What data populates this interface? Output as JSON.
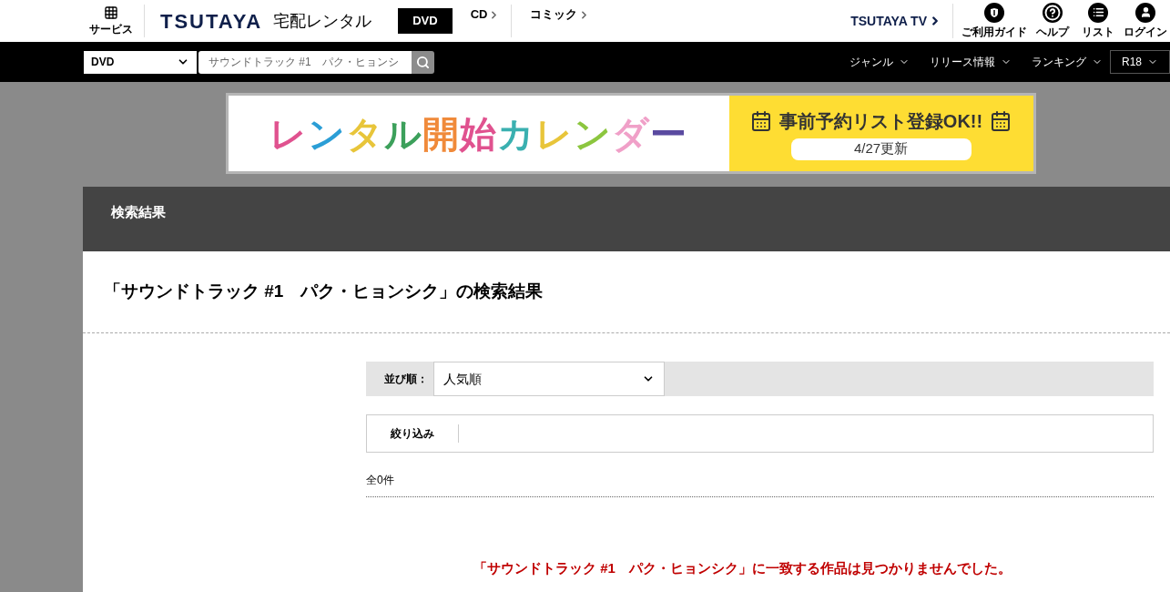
{
  "header": {
    "service_label": "サービス",
    "logo": "TSUTAYA",
    "service_name": "宅配レンタル",
    "tabs": [
      {
        "label": "DVD",
        "selected": true
      },
      {
        "label": "CD",
        "selected": false
      },
      {
        "label": "コミック",
        "selected": false
      }
    ],
    "tv_link": "TSUTAYA TV",
    "icon_links": [
      {
        "kind": "guide",
        "label": "ご利用ガイド"
      },
      {
        "kind": "help",
        "label": "ヘルプ"
      },
      {
        "kind": "list",
        "label": "リスト"
      },
      {
        "kind": "login",
        "label": "ログイン"
      }
    ]
  },
  "search_bar": {
    "category": "DVD",
    "query": "サウンドトラック #1　パク・ヒョンシ",
    "menus": [
      "ジャンル",
      "リリース情報",
      "ランキング"
    ],
    "rating_select": "R18"
  },
  "banner": {
    "title": "レンタル開始カレンダー",
    "subtitle": "事前予約リスト登録OK!!",
    "date": "4/27更新"
  },
  "section_header": "検索結果",
  "result_title": "「サウンドトラック #1　パク・ヒョンシク」の検索結果",
  "sort": {
    "label": "並び順：",
    "value": "人気順"
  },
  "filter_label": "絞り込み",
  "count": "全0件",
  "no_result_message": "「サウンドトラック #1　パク・ヒョンシク」に一致する作品は見つかりませんでした。"
}
